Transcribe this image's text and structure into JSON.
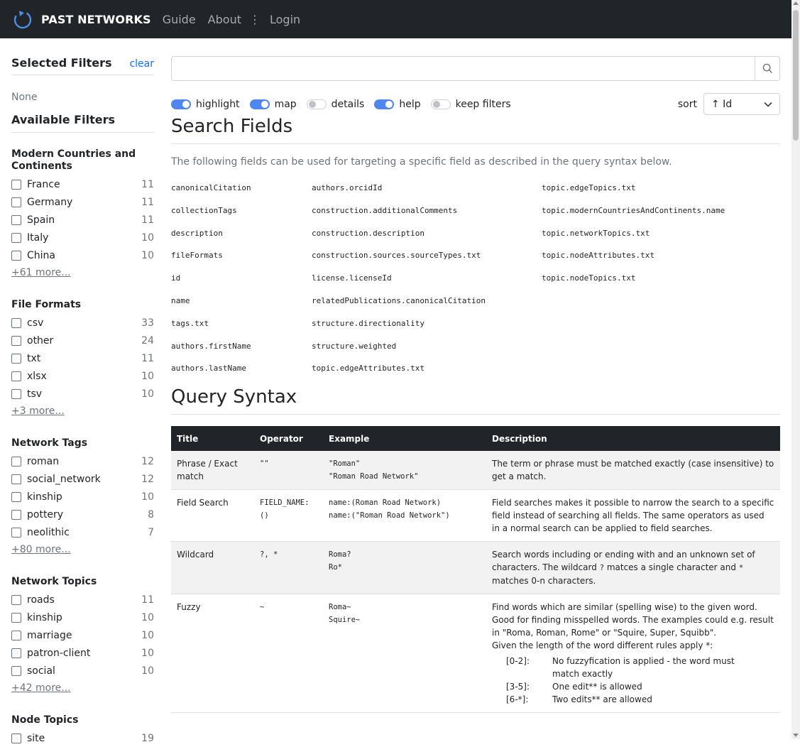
{
  "nav": {
    "brand": "PAST NETWORKS",
    "links": [
      "Guide",
      "About",
      "Login"
    ]
  },
  "sidebar": {
    "selected_title": "Selected Filters",
    "clear_label": "clear",
    "selected_value": "None",
    "available_title": "Available Filters",
    "groups": [
      {
        "title": "Modern Countries and Continents",
        "items": [
          {
            "label": "France",
            "count": "11"
          },
          {
            "label": "Germany",
            "count": "11"
          },
          {
            "label": "Spain",
            "count": "11"
          },
          {
            "label": "Italy",
            "count": "10"
          },
          {
            "label": "China",
            "count": "10"
          }
        ],
        "more": "+61 more..."
      },
      {
        "title": "File Formats",
        "items": [
          {
            "label": "csv",
            "count": "33"
          },
          {
            "label": "other",
            "count": "24"
          },
          {
            "label": "txt",
            "count": "11"
          },
          {
            "label": "xlsx",
            "count": "10"
          },
          {
            "label": "tsv",
            "count": "10"
          }
        ],
        "more": "+3 more..."
      },
      {
        "title": "Network Tags",
        "items": [
          {
            "label": "roman",
            "count": "12"
          },
          {
            "label": "social_network",
            "count": "12"
          },
          {
            "label": "kinship",
            "count": "10"
          },
          {
            "label": "pottery",
            "count": "8"
          },
          {
            "label": "neolithic",
            "count": "7"
          }
        ],
        "more": "+80 more..."
      },
      {
        "title": "Network Topics",
        "items": [
          {
            "label": "roads",
            "count": "11"
          },
          {
            "label": "kinship",
            "count": "10"
          },
          {
            "label": "marriage",
            "count": "10"
          },
          {
            "label": "patron-client",
            "count": "10"
          },
          {
            "label": "social",
            "count": "10"
          }
        ],
        "more": "+42 more..."
      },
      {
        "title": "Node Topics",
        "items": [
          {
            "label": "site",
            "count": "19"
          }
        ],
        "more": ""
      }
    ]
  },
  "search": {
    "value": "",
    "placeholder": ""
  },
  "toggles": [
    {
      "label": "highlight",
      "on": true
    },
    {
      "label": "map",
      "on": true
    },
    {
      "label": "details",
      "on": false
    },
    {
      "label": "help",
      "on": true
    },
    {
      "label": "keep filters",
      "on": false
    }
  ],
  "sort": {
    "label": "sort",
    "value": "↑ Id"
  },
  "search_fields": {
    "title": "Search Fields",
    "lead": "The following fields can be used for targeting a specific field as described in the query syntax below.",
    "columns": [
      [
        "canonicalCitation",
        "collectionTags",
        "description",
        "fileFormats",
        "id",
        "name",
        "tags.txt",
        "authors.firstName",
        "authors.lastName"
      ],
      [
        "authors.orcidId",
        "construction.additionalComments",
        "construction.description",
        "construction.sources.sourceTypes.txt",
        "license.licenseId",
        "relatedPublications.canonicalCitation",
        "structure.directionality",
        "structure.weighted",
        "topic.edgeAttributes.txt"
      ],
      [
        "topic.edgeTopics.txt",
        "topic.modernCountriesAndContinents.name",
        "topic.networkTopics.txt",
        "topic.nodeAttributes.txt",
        "topic.nodeTopics.txt",
        "",
        "",
        "",
        ""
      ]
    ]
  },
  "query_syntax": {
    "title": "Query Syntax",
    "headers": [
      "Title",
      "Operator",
      "Example",
      "Description"
    ],
    "rows": [
      {
        "title": "Phrase / Exact match",
        "operator": "\"\"",
        "example": [
          "\"Roman\"",
          "\"Roman Road Network\""
        ],
        "description": "The term or phrase must be matched exactly (case insensitive) to get a match."
      },
      {
        "title": "Field Search",
        "operator": "FIELD_NAME:()",
        "example": [
          "name:(Roman Road Network)",
          "name:(\"Roman Road Network\")"
        ],
        "description": "Field searches makes it possible to narrow the search to a specific field instead of searching all fields. The same operators as used in a normal search can be applied to field searches."
      },
      {
        "title": "Wildcard",
        "operator": "?, *",
        "example": [
          "Roma?",
          "Ro*"
        ],
        "description_parts": [
          "Search words including or ending with and an unknown set of characters. The wildcard ",
          "?",
          " matces a single character and ",
          "*",
          " matches 0-n characters."
        ]
      },
      {
        "title": "Fuzzy",
        "operator": "~",
        "example": [
          "Roma~",
          "Squire~"
        ],
        "description": "Find words which are similar (spelling wise) to the given word. Good for finding misspelled words. The examples could e.g. result in \"Roma, Roman, Rome\" or \"Squire, Super, Squibb\".",
        "description2": "Given the length of the word different rules apply *:",
        "rules": [
          {
            "range": "[0-2]:",
            "text": "No fuzzyfication is applied - the word must match exactly"
          },
          {
            "range": "[3-5]:",
            "text": "One edit** is allowed"
          },
          {
            "range": "[6-*]:",
            "text": "Two edits** are allowed"
          }
        ]
      }
    ]
  },
  "colors": {
    "navbar": "#212529",
    "accent": "#0d6efd",
    "switch_on": "#4f86f0"
  }
}
